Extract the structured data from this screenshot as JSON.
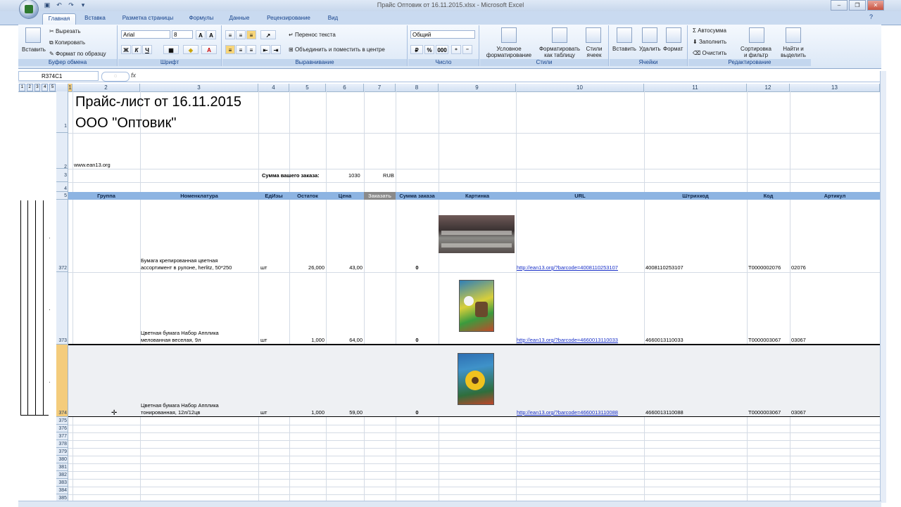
{
  "window": {
    "title": "Прайс Оптовик от 16.11.2015.xlsx - Microsoft Excel",
    "controls": [
      "–",
      "❐",
      "✕"
    ]
  },
  "tabs": [
    "Главная",
    "Вставка",
    "Разметка страницы",
    "Формулы",
    "Данные",
    "Рецензирование",
    "Вид"
  ],
  "ribbon": {
    "clipboard": {
      "label": "Буфер обмена",
      "paste": "Вставить",
      "cut": "Вырезать",
      "copy": "Копировать",
      "format_painter": "Формат по образцу"
    },
    "font": {
      "label": "Шрифт",
      "name": "Arial",
      "size": "8",
      "bold": "Ж",
      "italic": "К",
      "underline": "Ч"
    },
    "alignment": {
      "label": "Выравнивание",
      "wrap": "Перенос текста",
      "merge": "Объединить и поместить в центре"
    },
    "number": {
      "label": "Число",
      "format": "Общий",
      "percent": "%",
      "thousands": "000"
    },
    "styles": {
      "label": "Стили",
      "conditional": "Условное форматирование",
      "as_table": "Форматировать как таблицу",
      "cell_styles": "Стили ячеек"
    },
    "cells": {
      "label": "Ячейки",
      "insert": "Вставить",
      "delete": "Удалить",
      "format": "Формат"
    },
    "editing": {
      "label": "Редактирование",
      "autosum": "Автосумма",
      "fill": "Заполнить",
      "clear": "Очистить",
      "sort": "Сортировка и фильтр",
      "find": "Найти и выделить"
    }
  },
  "formula_bar": {
    "name_box": "R374C1",
    "fx": "fx",
    "content": ""
  },
  "outline_levels": [
    "1",
    "2",
    "3",
    "4",
    "5"
  ],
  "columns": [
    "1",
    "2",
    "3",
    "4",
    "5",
    "6",
    "7",
    "8",
    "9",
    "10",
    "11",
    "12",
    "13"
  ],
  "sheet": {
    "title_line1": "Прайс-лист от 16.11.2015",
    "title_line2": "ООО \"Оптовик\"",
    "site": "www.ean13.org",
    "order_label": "Сумма вашего заказа:",
    "order_sum": "1030",
    "currency": "RUB",
    "headers": [
      "Группа",
      "Номенклатура",
      "ЕдИзы",
      "Остаток",
      "Цена",
      "Заказать",
      "Сумма заказа",
      "Картинка",
      "URL",
      "Штрихкод",
      "Код",
      "Артикул"
    ],
    "items": [
      {
        "row": "372",
        "name1": "Бумага крепированная цветная",
        "name2": "ассортимент в рулоне, herlitz, 50*250",
        "unit": "шт",
        "stock": "26,000",
        "price": "43,00",
        "sum": "0",
        "url": "http://ean13.org/?barcode=4008110253107",
        "barcode": "4008110253107",
        "code": "Т0000002076",
        "article": "02076"
      },
      {
        "row": "373",
        "name1": "Цветная бумага Набор  Аппликa",
        "name2": "мелованная веселая, 9л",
        "unit": "шт",
        "stock": "1,000",
        "price": "64,00",
        "sum": "0",
        "url": "http://ean13.org/?barcode=4660013110033",
        "barcode": "4660013110033",
        "code": "Т0000003067",
        "article": "03067"
      },
      {
        "row": "374",
        "name1": "Цветная бумага Набор  Аппликa",
        "name2": "тонированная, 12л/12цв",
        "unit": "шт",
        "stock": "1,000",
        "price": "59,00",
        "sum": "0",
        "url": "http://ean13.org/?barcode=4660013110088",
        "barcode": "4660013110088",
        "code": "Т0000003067",
        "article": "03067"
      }
    ],
    "row_numbers": [
      "1",
      "2",
      "3",
      "4",
      "5"
    ],
    "empty_rows": [
      "375",
      "376",
      "377",
      "378",
      "379",
      "380",
      "381",
      "382",
      "383",
      "384",
      "385"
    ]
  }
}
